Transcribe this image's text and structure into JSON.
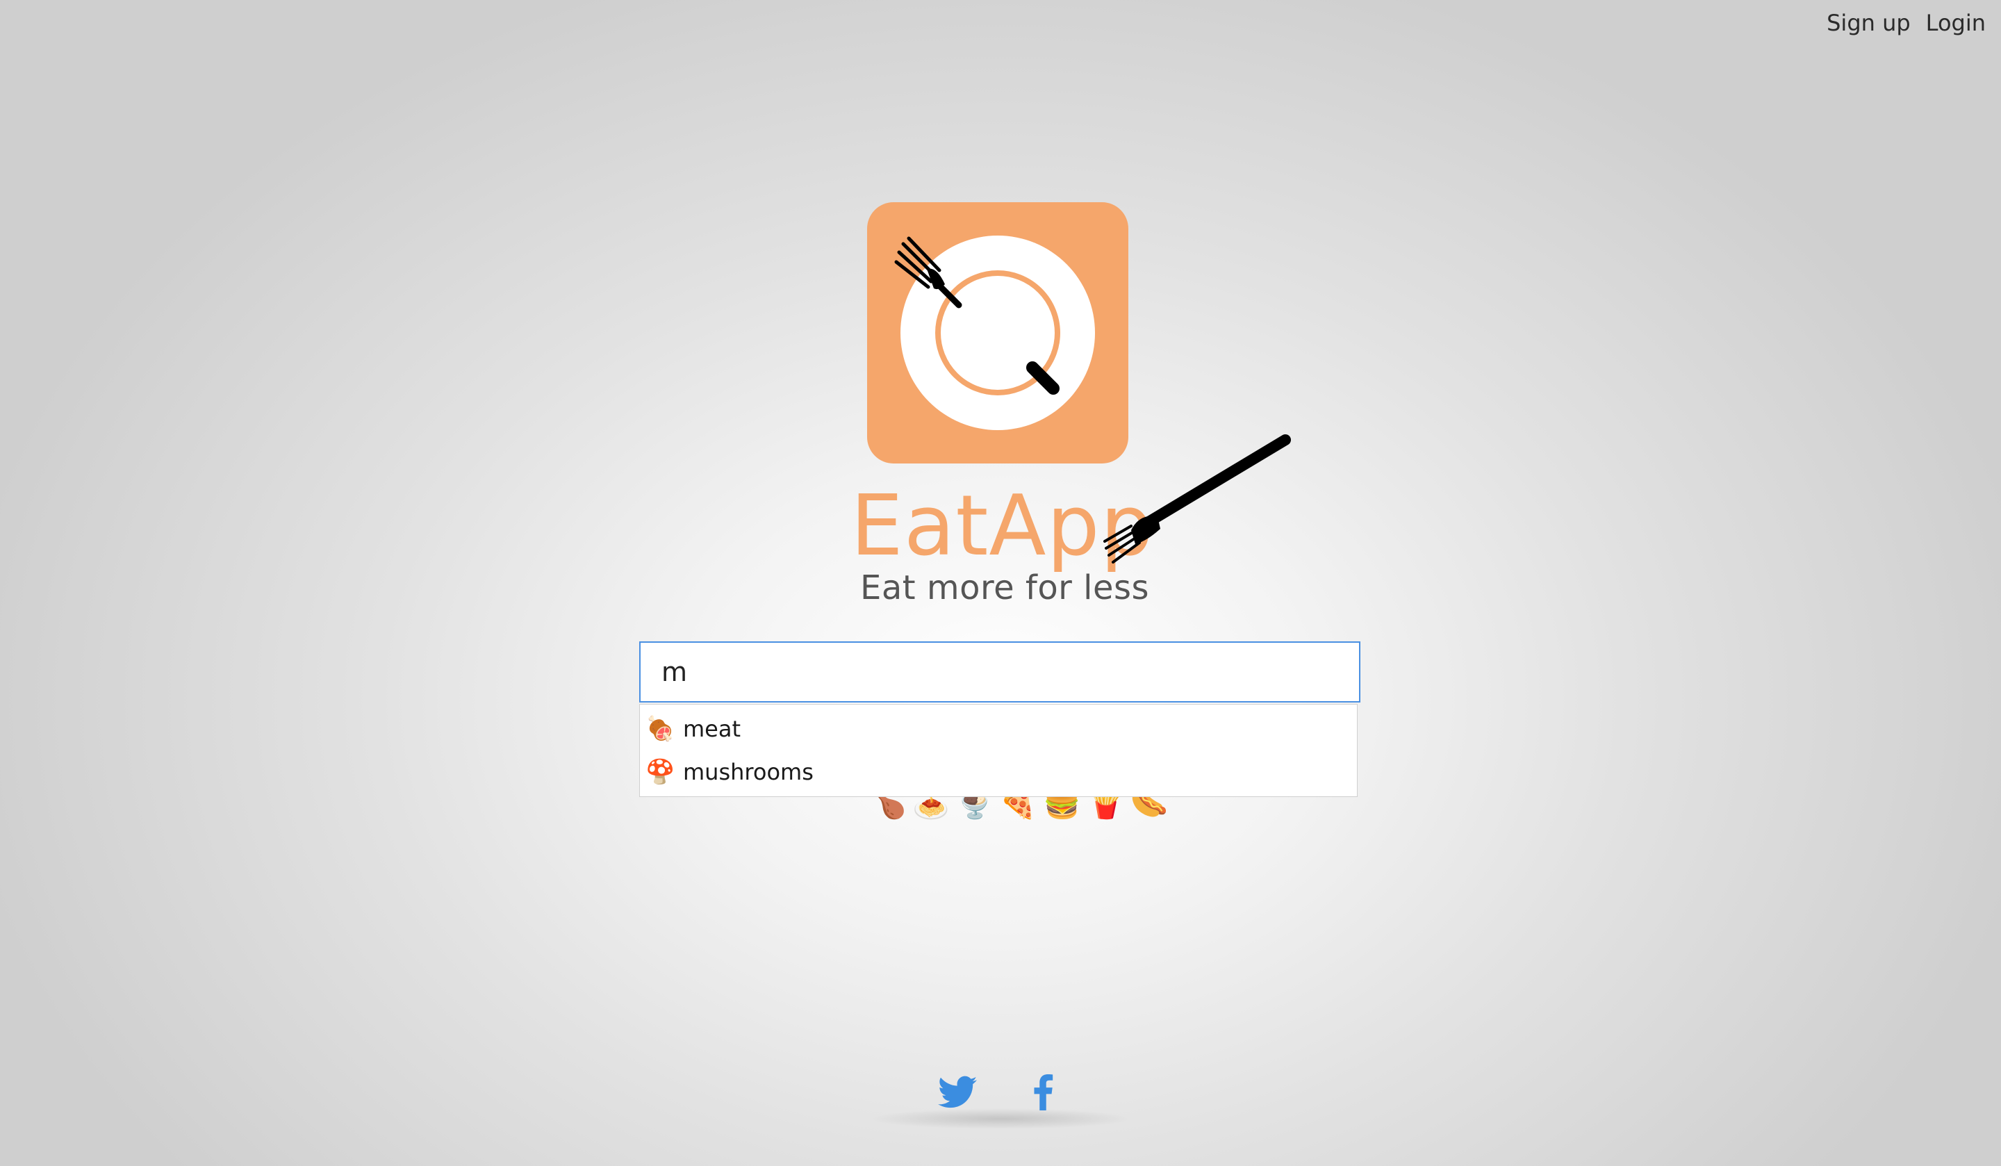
{
  "nav": {
    "signup_label": "Sign up",
    "login_label": "Login"
  },
  "brand": {
    "name": "EatApp",
    "tagline": "Eat more for less",
    "colors": {
      "accent": "#f5a66b",
      "tile": "#f5a66b",
      "plate": "#ffffff",
      "utensil": "#000000",
      "input_border": "#4a90e2"
    }
  },
  "search": {
    "value": "m",
    "suggestions": [
      {
        "icon": "meat-on-bone-icon",
        "glyph": "🍖",
        "label": "meat"
      },
      {
        "icon": "mushroom-icon",
        "glyph": "🍄",
        "label": "mushrooms"
      }
    ]
  },
  "food_emojis": [
    "🍗",
    "🍝",
    "🍨",
    "🍕",
    "🍔",
    "🍟",
    "🌭"
  ],
  "social": {
    "twitter_icon": "twitter-icon",
    "facebook_icon": "facebook-icon",
    "color": "#3b8de0"
  }
}
